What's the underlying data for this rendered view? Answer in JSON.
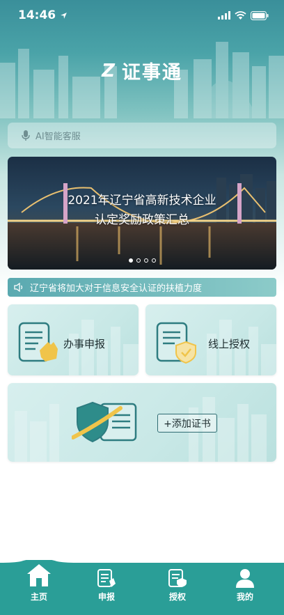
{
  "status_bar": {
    "time": "14:46"
  },
  "app": {
    "title": "证事通",
    "logo_mark": "Z"
  },
  "search": {
    "placeholder": "AI智能客服"
  },
  "banner": {
    "line1": "2021年辽宁省高新技术企业",
    "line2": "认定奖励政策汇总",
    "dots_total": 4,
    "active_dot": 1
  },
  "notice": {
    "text": "辽宁省将加大对于信息安全认证的扶植力度"
  },
  "cards": {
    "declare": "办事申报",
    "authorize": "线上授权",
    "add_cert": "+添加证书"
  },
  "tabbar": {
    "items": [
      {
        "label": "主页",
        "icon": "home-icon"
      },
      {
        "label": "申报",
        "icon": "declare-icon"
      },
      {
        "label": "授权",
        "icon": "authorize-icon"
      },
      {
        "label": "我的",
        "icon": "user-icon"
      }
    ],
    "active": 0
  },
  "colors": {
    "primary": "#2e9e98",
    "tab_bg": "#2a9e97",
    "accent_yellow": "#f0c44a"
  }
}
